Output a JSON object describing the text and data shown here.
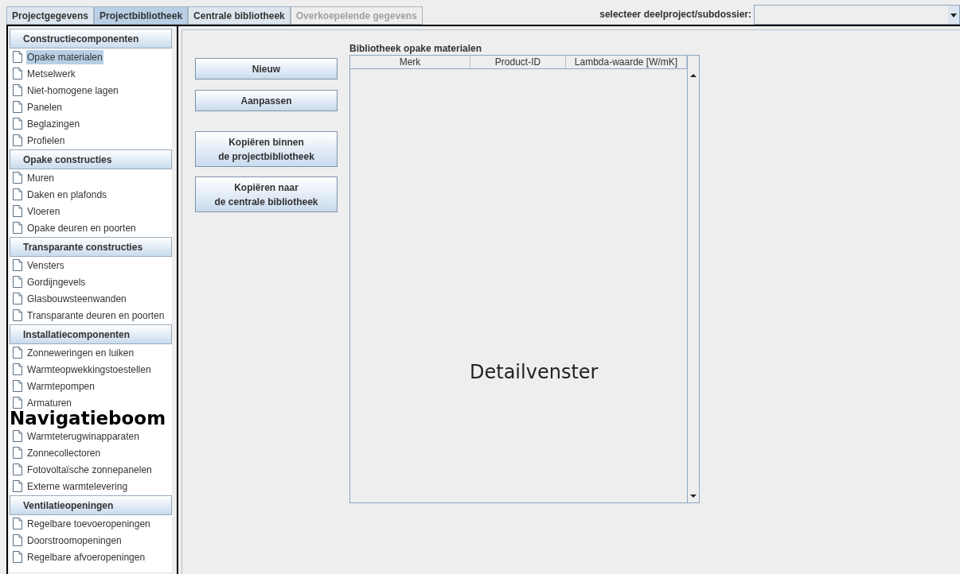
{
  "tabs": [
    {
      "label": "Projectgegevens",
      "selected": false,
      "disabled": false
    },
    {
      "label": "Projectbibliotheek",
      "selected": true,
      "disabled": false
    },
    {
      "label": "Centrale bibliotheek",
      "selected": false,
      "disabled": false
    },
    {
      "label": "Overkoepelende gegevens",
      "selected": false,
      "disabled": true
    }
  ],
  "subproject_selector": {
    "label": "selecteer deelproject/subdossier:"
  },
  "navigation": {
    "sections": [
      {
        "title": "Constructiecomponenten",
        "items": [
          {
            "label": "Opake materialen",
            "selected": true
          },
          {
            "label": "Metselwerk",
            "selected": false
          },
          {
            "label": "Niet-homogene lagen",
            "selected": false
          },
          {
            "label": "Panelen",
            "selected": false
          },
          {
            "label": "Beglazingen",
            "selected": false
          },
          {
            "label": "Profielen",
            "selected": false
          }
        ]
      },
      {
        "title": "Opake constructies",
        "items": [
          {
            "label": "Muren",
            "selected": false
          },
          {
            "label": "Daken en plafonds",
            "selected": false
          },
          {
            "label": "Vloeren",
            "selected": false
          },
          {
            "label": "Opake deuren en poorten",
            "selected": false
          }
        ]
      },
      {
        "title": "Transparante constructies",
        "items": [
          {
            "label": "Vensters",
            "selected": false
          },
          {
            "label": "Gordijngevels",
            "selected": false
          },
          {
            "label": "Glasbouwsteenwanden",
            "selected": false
          },
          {
            "label": "Transparante deuren en poorten",
            "selected": false
          }
        ]
      },
      {
        "title": "Installatiecomponenten",
        "items": [
          {
            "label": "Zonneweringen en luiken",
            "selected": false
          },
          {
            "label": "Warmteopwekkingstoestellen",
            "selected": false
          },
          {
            "label": "Warmtepompen",
            "selected": false
          },
          {
            "label": "Armaturen",
            "selected": false
          },
          {
            "kind": "covered"
          },
          {
            "label": "Warmteterugwinapparaten",
            "selected": false
          },
          {
            "label": "Zonnecollectoren",
            "selected": false
          },
          {
            "label": "Fotovoltaïsche zonnepanelen",
            "selected": false
          },
          {
            "label": "Externe warmtelevering",
            "selected": false
          }
        ]
      },
      {
        "title": "Ventilatieopeningen",
        "items": [
          {
            "label": "Regelbare toevoeropeningen",
            "selected": false
          },
          {
            "label": "Doorstroomopeningen",
            "selected": false
          },
          {
            "label": "Regelbare afvoeropeningen",
            "selected": false
          }
        ]
      }
    ]
  },
  "buttons": [
    {
      "label": "Nieuw"
    },
    {
      "label": "Aanpassen"
    },
    {
      "label": "Kopiëren binnen\nde projectbibliotheek"
    },
    {
      "label": "Kopiëren naar\nde centrale bibliotheek"
    }
  ],
  "library_table": {
    "title": "Bibliotheek opake materialen",
    "columns": [
      "Merk",
      "Product-ID",
      "Lambda-waarde [W/mK]"
    ]
  },
  "annotations": [
    {
      "label": "Navigatieboom"
    },
    {
      "label": "Detailvenster"
    }
  ]
}
